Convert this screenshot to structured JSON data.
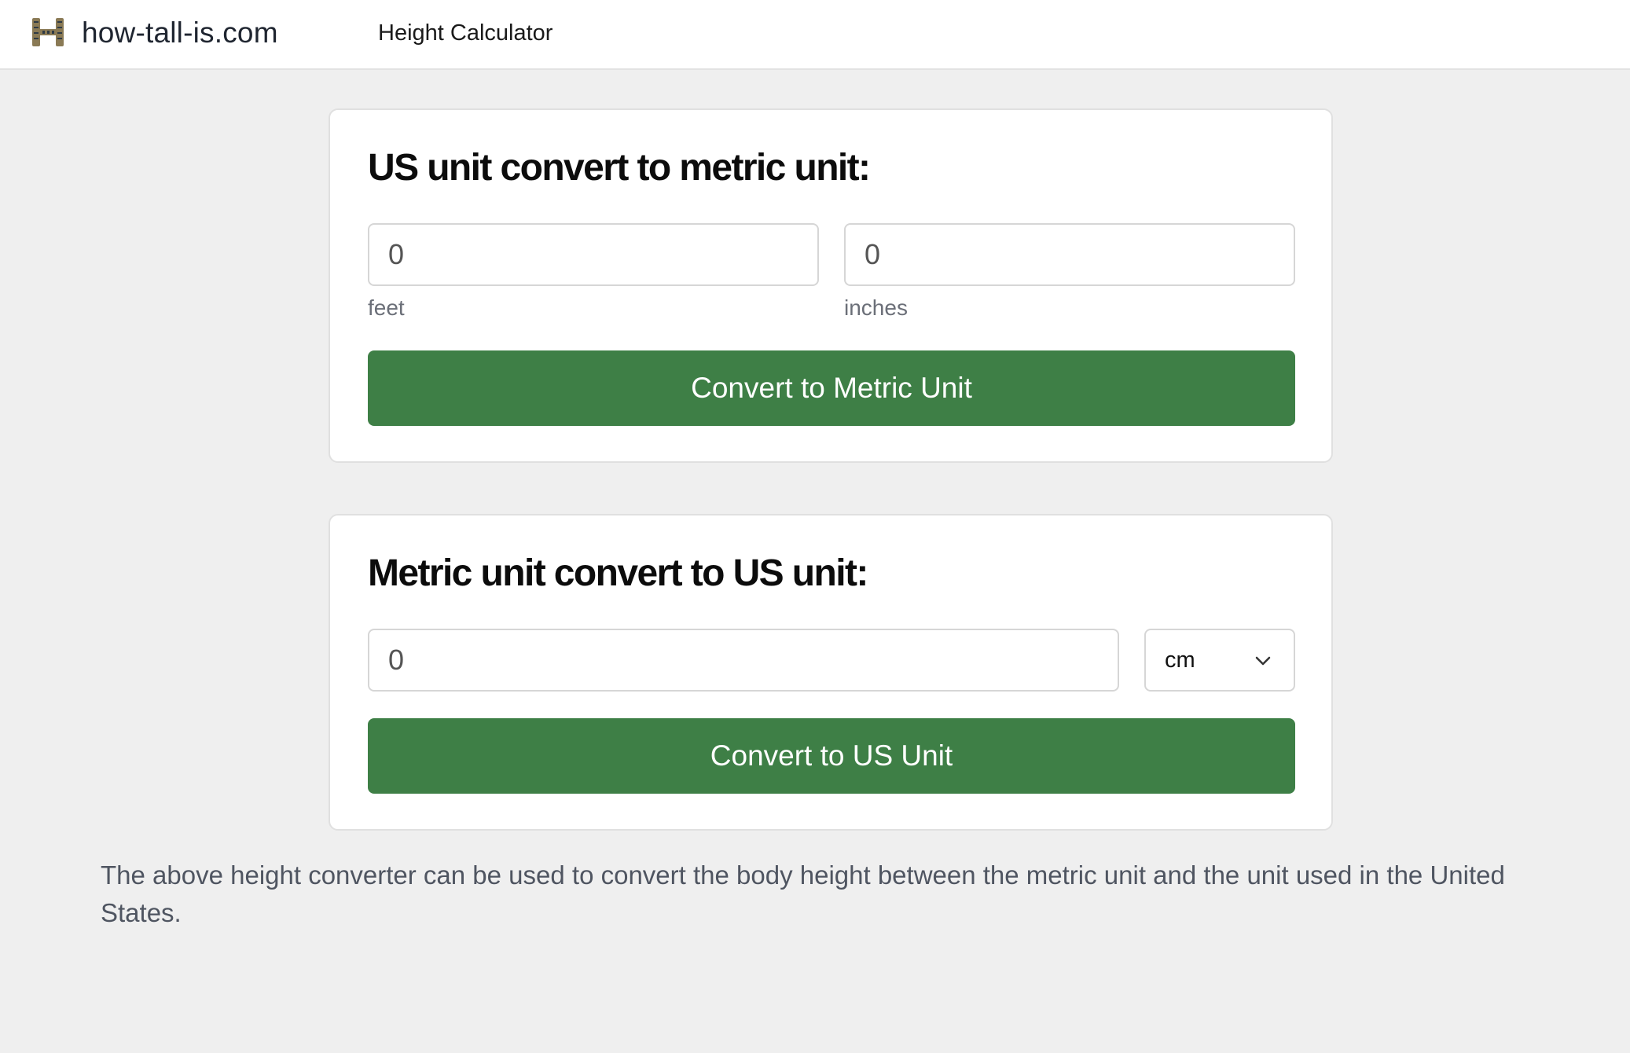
{
  "header": {
    "logo_icon": "ruler-h-logo-icon",
    "brand": "how-tall-is.com",
    "nav_link": "Height Calculator"
  },
  "us_to_metric": {
    "title": "US unit convert to metric unit:",
    "feet_value": "0",
    "feet_label": "feet",
    "inches_value": "0",
    "inches_label": "inches",
    "button_label": "Convert to Metric Unit"
  },
  "metric_to_us": {
    "title": "Metric unit convert to US unit:",
    "value": "0",
    "unit_selected": "cm",
    "dropdown_icon": "chevron-down-icon",
    "button_label": "Convert to US Unit"
  },
  "description": "The above height converter can be used to convert the body height between the metric unit and the unit used in the United States.",
  "colors": {
    "background": "#efefef",
    "button": "#3e7f46",
    "card": "#ffffff"
  }
}
